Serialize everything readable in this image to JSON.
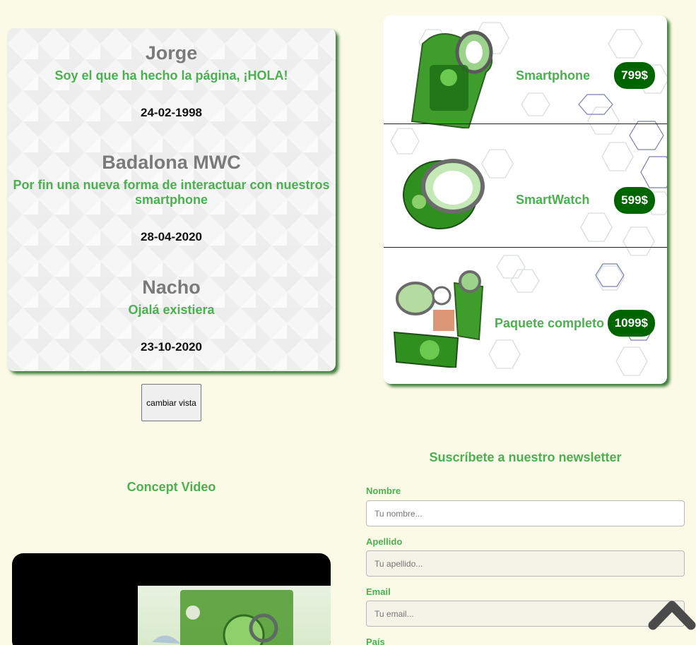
{
  "posts": [
    {
      "name": "Jorge",
      "text": "Soy el que ha hecho la página, ¡HOLA!",
      "date": "24-02-1998"
    },
    {
      "name": "Badalona MWC",
      "text": "Por fin una nueva forma de interactuar con nuestros smartphone",
      "date": "28-04-2020"
    },
    {
      "name": "Nacho",
      "text": "Ojalá existiera",
      "date": "23-10-2020"
    }
  ],
  "switch_view_label": "cambiar vista",
  "products": [
    {
      "name": "Smartphone",
      "price": "799$",
      "icon": "smartphone-image"
    },
    {
      "name": "SmartWatch",
      "price": "599$",
      "icon": "smartwatch-image"
    },
    {
      "name": "Paquete completo",
      "price": "1099$",
      "icon": "bundle-image"
    }
  ],
  "video": {
    "title": "Concept Video"
  },
  "newsletter": {
    "title": "Suscríbete a nuestro newsletter",
    "fields": [
      {
        "label": "Nombre",
        "placeholder": "Tu nombre..."
      },
      {
        "label": "Apellido",
        "placeholder": "Tu apellido..."
      },
      {
        "label": "Email",
        "placeholder": "Tu email..."
      },
      {
        "label": "País"
      }
    ]
  },
  "colors": {
    "background": "#fafae6",
    "accent_green": "#4caf50",
    "price_badge": "#006400",
    "heading_gray": "#7a7a7a"
  },
  "scroll_top_icon": "chevron-up-icon"
}
